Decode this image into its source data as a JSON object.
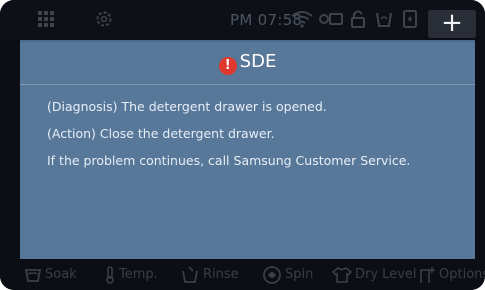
{
  "status_bar": {
    "time": "PM 07:58",
    "icons": [
      "grid-icon",
      "settings-icon",
      "wifi-icon",
      "child-lock-icon",
      "door-lock-icon",
      "eco-icon",
      "smart-control-icon"
    ],
    "plus_label": "+"
  },
  "dialog": {
    "title": "SDE",
    "icon": "warning-icon",
    "icon_glyph": "!",
    "diagnosis": "(Diagnosis) The detergent drawer is opened.",
    "action": "(Action) Close the detergent drawer.",
    "help": "If the problem continues, call Samsung Customer Service."
  },
  "bottom_bar": {
    "items": [
      {
        "label": "Soak",
        "icon": "soak-icon"
      },
      {
        "label": "Temp.",
        "icon": "thermometer-icon"
      },
      {
        "label": "Rinse",
        "icon": "rinse-icon"
      },
      {
        "label": "Spin",
        "icon": "spin-icon"
      },
      {
        "label": "Dry Level",
        "icon": "shirt-icon"
      },
      {
        "label": "Options",
        "icon": "options-icon"
      }
    ]
  },
  "colors": {
    "dialog_bg": "#58789a",
    "warning": "#e0382e",
    "screen_bg": "#0b0e14"
  }
}
